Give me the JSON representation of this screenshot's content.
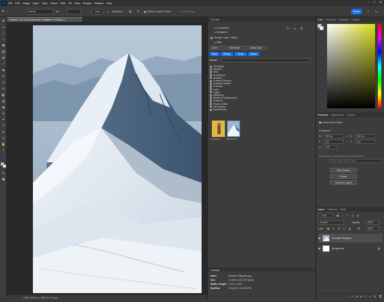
{
  "menubar": {
    "logo": "Ps",
    "items": [
      "File",
      "Edit",
      "Image",
      "Layer",
      "Type",
      "Select",
      "Filter",
      "3D",
      "View",
      "Plugins",
      "Window",
      "Help"
    ],
    "window_controls": [
      "–",
      "□",
      "✕"
    ]
  },
  "options": {
    "style_value": "Normal",
    "clear_label": "Clear",
    "straighten_label": "Straighten",
    "delete_cropped_label": "Delete Cropped Pixels",
    "content_aware_label": "Content-Aware",
    "share_label": "Share"
  },
  "document": {
    "tab_title": "Untitled-1 @ 100% (Mountain Ridgeline, RGB/8*) ×",
    "status_text": "100%      1000 px x 1500 px (72 ppi)"
  },
  "hub": {
    "title": "CC Hub",
    "connections_label": "Connections",
    "navigation_label": "Navigation",
    "library_label": "Change Login / Library",
    "filter_label": "Filter",
    "filter_tabs": [
      "Color",
      "Orientation",
      "Media Type"
    ],
    "action_buttons": [
      "Stock",
      "Bitmap",
      "Vector",
      "Adobe"
    ],
    "result_label": "Result",
    "categories": [
      "3D Assets",
      "Abstract",
      "AEM",
      "Architecture",
      "Archives",
      "Creative Services",
      "Extracted assets",
      "Featured",
      "Icons",
      "Logos",
      "Marketing",
      "Media & Entertainment",
      "Outdoors",
      "Product Sales",
      "Site content",
      "Social Media"
    ],
    "thumbnails": [
      {
        "caption": "ian-dodds-3..."
      },
      {
        "caption": "Mountain Ri..."
      }
    ],
    "details": {
      "title": "Details",
      "rows": [
        {
          "key": "Name",
          "value": "Mountain Ridgeline.jpg"
        },
        {
          "key": "Size",
          "value": "1.3 MB (1,391,297 Bytes)"
        },
        {
          "key": "Width x Height",
          "value": "2,791 x 4,351"
        },
        {
          "key": "Modified",
          "value": "1/10/2023, 3:38:28 PM"
        }
      ]
    }
  },
  "color_panel": {
    "tabs": [
      "Color",
      "Swatches",
      "Gradients",
      "Patterns"
    ]
  },
  "properties": {
    "tabs": [
      "Properties",
      "Adjustments",
      "Libraries"
    ],
    "object_label": "Linked Smart Object",
    "transform_label": "Transform",
    "w_value": "1000 px",
    "h_value": "1500 px",
    "x_value": "0 px",
    "y_value": "0 px",
    "angle_value": "0.00°",
    "path_text": "C:\\Users\\adam.smith@nbcuni.com\\CC Hub\\Mountain",
    "layer_comp_placeholder": "Don't Apply Layer Comp",
    "buttons": [
      "Edit Contents",
      "Embed",
      "Convert to Layers"
    ]
  },
  "layers_panel": {
    "tabs": [
      "Layers",
      "Channels",
      "Paths"
    ],
    "kind_label": "Kind",
    "blend_mode": "Normal",
    "opacity_label": "Opacity:",
    "opacity_value": "100%",
    "lock_label": "Lock:",
    "fill_label": "Fill:",
    "fill_value": "100%",
    "layers": [
      {
        "name": "Mountain Ridgeline"
      },
      {
        "name": "Background"
      }
    ]
  }
}
